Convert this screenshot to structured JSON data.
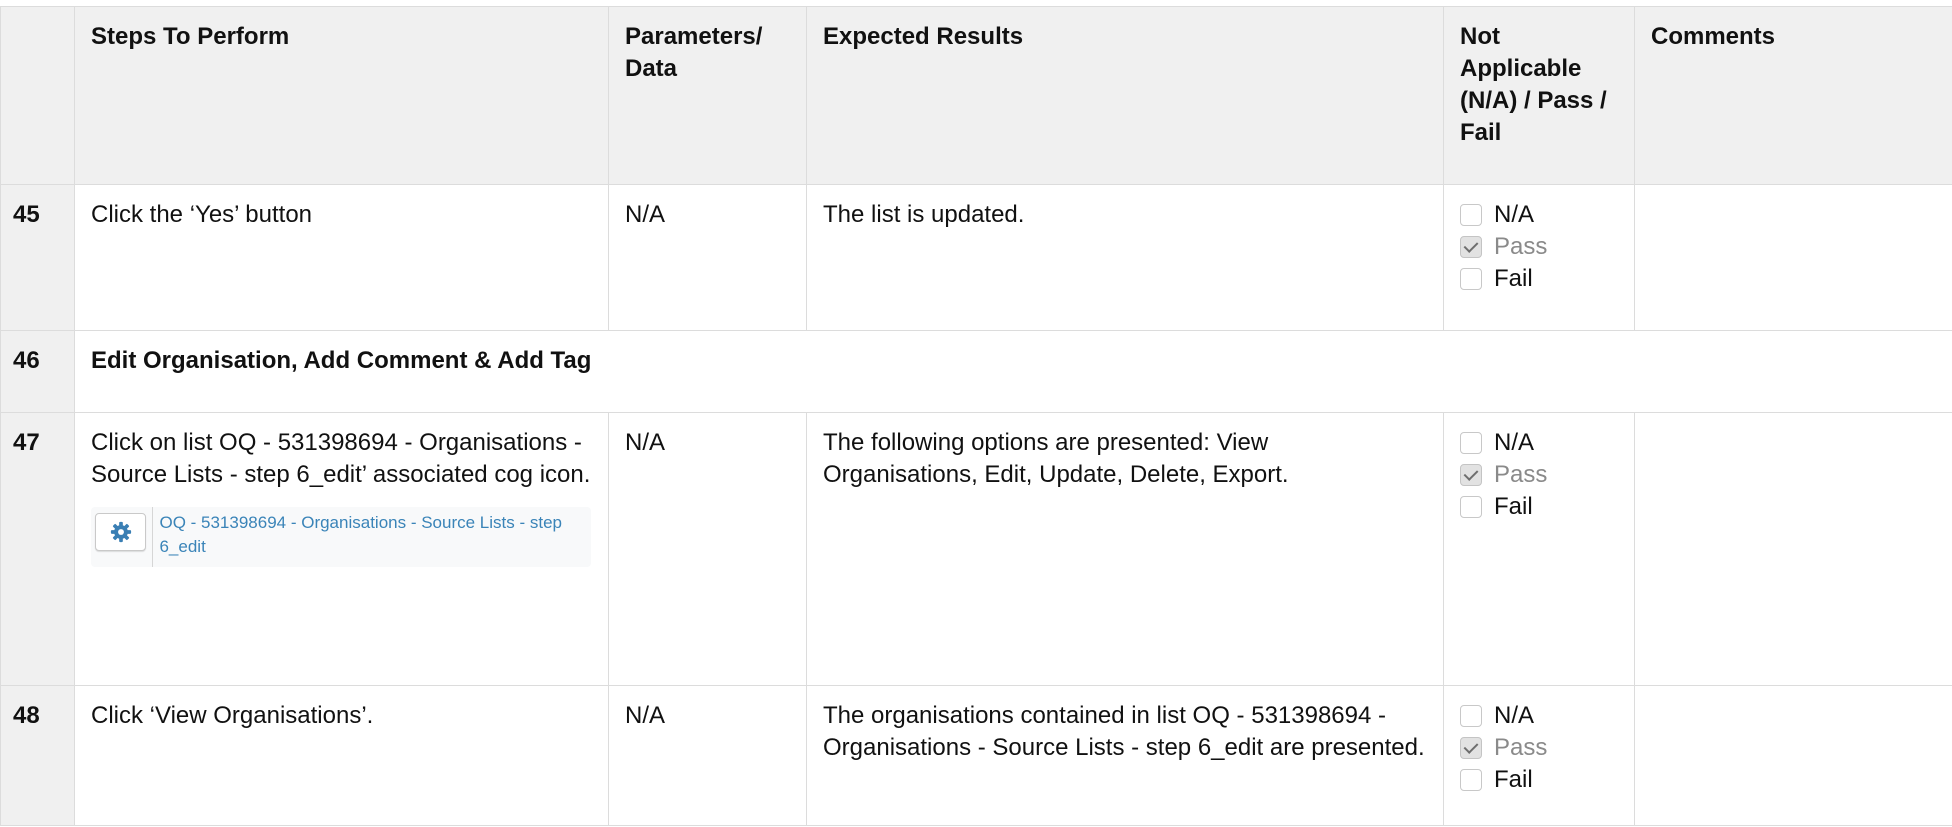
{
  "headers": {
    "step": "Steps To Perform",
    "params": "Parameters/ Data",
    "expected": "Expected Results",
    "status": "Not Applicable (N/A) / Pass / Fail",
    "comments": "Comments"
  },
  "status_options": {
    "na": "N/A",
    "pass": "Pass",
    "fail": "Fail"
  },
  "rows": {
    "r45": {
      "num": "45",
      "step": "Click the ‘Yes’ button",
      "params": "N/A",
      "expected": "The list is updated.",
      "selected": "Pass"
    },
    "r46": {
      "num": "46",
      "section_title": "Edit Organisation, Add Comment & Add Tag"
    },
    "r47": {
      "num": "47",
      "step": "Click on list OQ - 531398694 - Organisations - Source Lists - step 6_edit’ associated cog icon.",
      "list_link": "OQ - 531398694 - Organisations - Source Lists - step 6_edit",
      "params": "N/A",
      "expected": "The following options are presented: View Organisations, Edit, Update, Delete, Export.",
      "selected": "Pass"
    },
    "r48": {
      "num": "48",
      "step": "Click ‘View Organisations’.",
      "params": "N/A",
      "expected": "The organisations contained in list OQ - 531398694 - Organisations - Source Lists - step 6_edit are presented.",
      "selected": "Pass"
    }
  },
  "icons": {
    "cog": "cog-icon",
    "checkbox_checked": "checkmark-icon"
  },
  "colors": {
    "header_bg": "#f0f0f0",
    "link": "#3a84b8",
    "border": "#dcdcdc"
  }
}
